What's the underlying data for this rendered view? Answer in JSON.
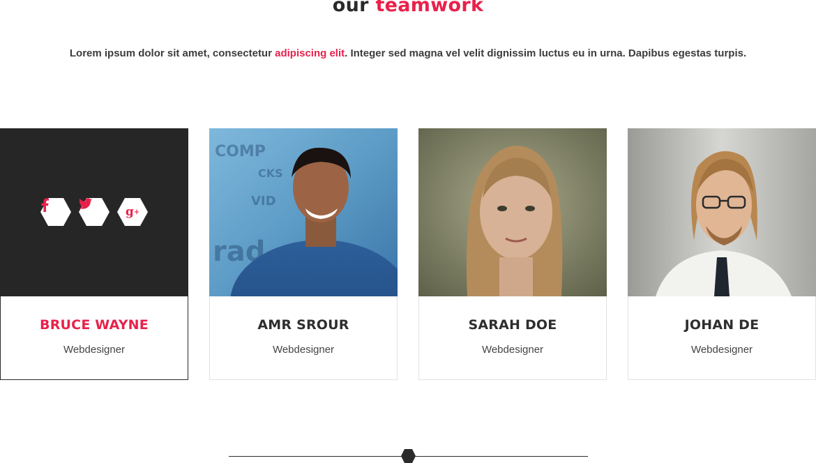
{
  "section": {
    "title_plain": "our",
    "title_accent": "teamwork",
    "intro_before": "Lorem ipsum dolor sit amet, consectetur ",
    "intro_link": "adipiscing elit",
    "intro_after": ". Integer sed magna vel velit dignissim luctus eu in urna. Dapibus egestas turpis."
  },
  "team": [
    {
      "name": "BRUCE WAYNE",
      "role": "Webdesigner"
    },
    {
      "name": "AMR SROUR",
      "role": "Webdesigner"
    },
    {
      "name": "SARAH DOE",
      "role": "Webdesigner"
    },
    {
      "name": "JOHAN DE",
      "role": "Webdesigner"
    }
  ],
  "socials": [
    {
      "icon": "facebook-icon",
      "glyph": "f"
    },
    {
      "icon": "twitter-icon",
      "glyph": "🐦"
    },
    {
      "icon": "google-plus-icon",
      "glyph": "g+"
    }
  ],
  "colors": {
    "accent": "#e8214b",
    "dark": "#262626",
    "text": "#333333"
  }
}
